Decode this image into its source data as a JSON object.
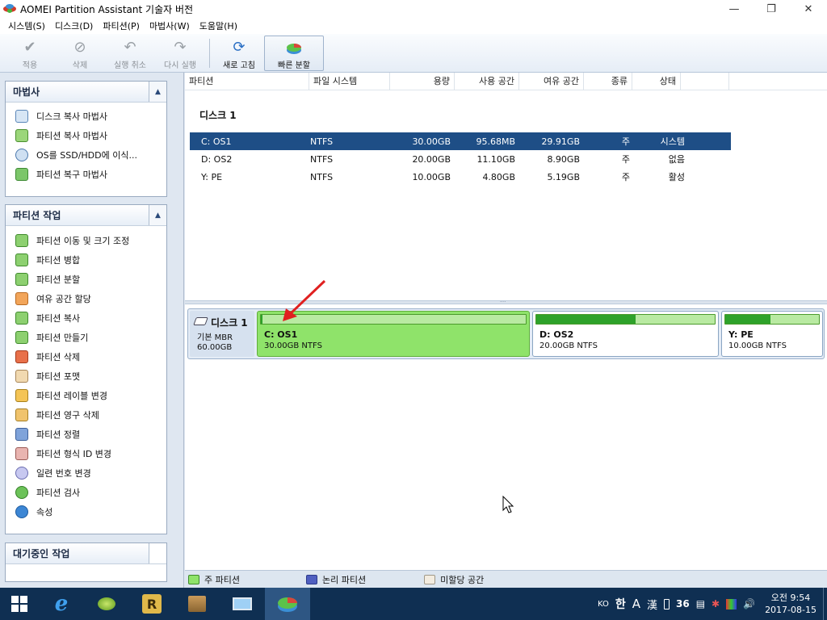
{
  "window": {
    "title": "AOMEI Partition Assistant 기술자 버전",
    "controls": [
      "minimize",
      "maximize",
      "close"
    ]
  },
  "menu": [
    "시스템(S)",
    "디스크(D)",
    "파티션(P)",
    "마법사(W)",
    "도움말(H)"
  ],
  "toolbar": {
    "apply": "적용",
    "discard": "삭제",
    "undo": "실행 취소",
    "redo": "다시 실행",
    "refresh": "새로 고침",
    "quick_split": "빠른 분할"
  },
  "wizard_panel": {
    "title": "마법사",
    "items": [
      "디스크 복사 마법사",
      "파티션 복사 마법사",
      "OS를 SSD/HDD에 이식...",
      "파티션 복구 마법사"
    ]
  },
  "partition_panel": {
    "title": "파티션 작업",
    "items": [
      "파티션 이동 및 크기 조정",
      "파티션 병합",
      "파티션 분할",
      "여유 공간 할당",
      "파티션 복사",
      "파티션 만들기",
      "파티션 삭제",
      "파티션 포맷",
      "파티션 레이블 변경",
      "파티션 영구 삭제",
      "파티션 정렬",
      "파티션 형식 ID 변경",
      "일련 번호 변경",
      "파티션 검사",
      "속성"
    ]
  },
  "pending_panel": {
    "title": "대기중인 작업"
  },
  "table": {
    "columns": [
      "파티션",
      "파일 시스템",
      "용량",
      "사용 공간",
      "여유 공간",
      "종류",
      "상태"
    ],
    "disk_label": "디스크 1",
    "rows": [
      {
        "partition": "C: OS1",
        "fs": "NTFS",
        "capacity": "30.00GB",
        "used": "95.68MB",
        "free": "29.91GB",
        "type": "주",
        "status": "시스템"
      },
      {
        "partition": "D: OS2",
        "fs": "NTFS",
        "capacity": "20.00GB",
        "used": "11.10GB",
        "free": "8.90GB",
        "type": "주",
        "status": "없음"
      },
      {
        "partition": "Y: PE",
        "fs": "NTFS",
        "capacity": "10.00GB",
        "used": "4.80GB",
        "free": "5.19GB",
        "type": "주",
        "status": "활성"
      }
    ]
  },
  "diskmap": {
    "disk_name": "디스크 1",
    "disk_type": "기본 MBR",
    "disk_size": "60.00GB",
    "partitions": [
      {
        "name": "C: OS1",
        "detail": "30.00GB NTFS",
        "used_fraction": 0.003
      },
      {
        "name": "D: OS2",
        "detail": "20.00GB NTFS",
        "used_fraction": 0.555
      },
      {
        "name": "Y: PE",
        "detail": "10.00GB NTFS",
        "used_fraction": 0.48
      }
    ]
  },
  "legend": {
    "primary": "주 파티션",
    "logical": "논리 파티션",
    "unallocated": "미할당 공간"
  },
  "taskbar": {
    "lang": "KO",
    "ime_hangul": "한",
    "ime_a": "A",
    "ime_hanja": "漢",
    "tray_num": "36",
    "time": "오전 9:54",
    "date": "2017-08-15"
  },
  "colors": {
    "selected_row": "#1e4e86",
    "primary_partition": "#8fe36a",
    "logical_partition": "#4f5fc0",
    "unallocated": "#f3ece0",
    "taskbar": "#0f2f52"
  }
}
